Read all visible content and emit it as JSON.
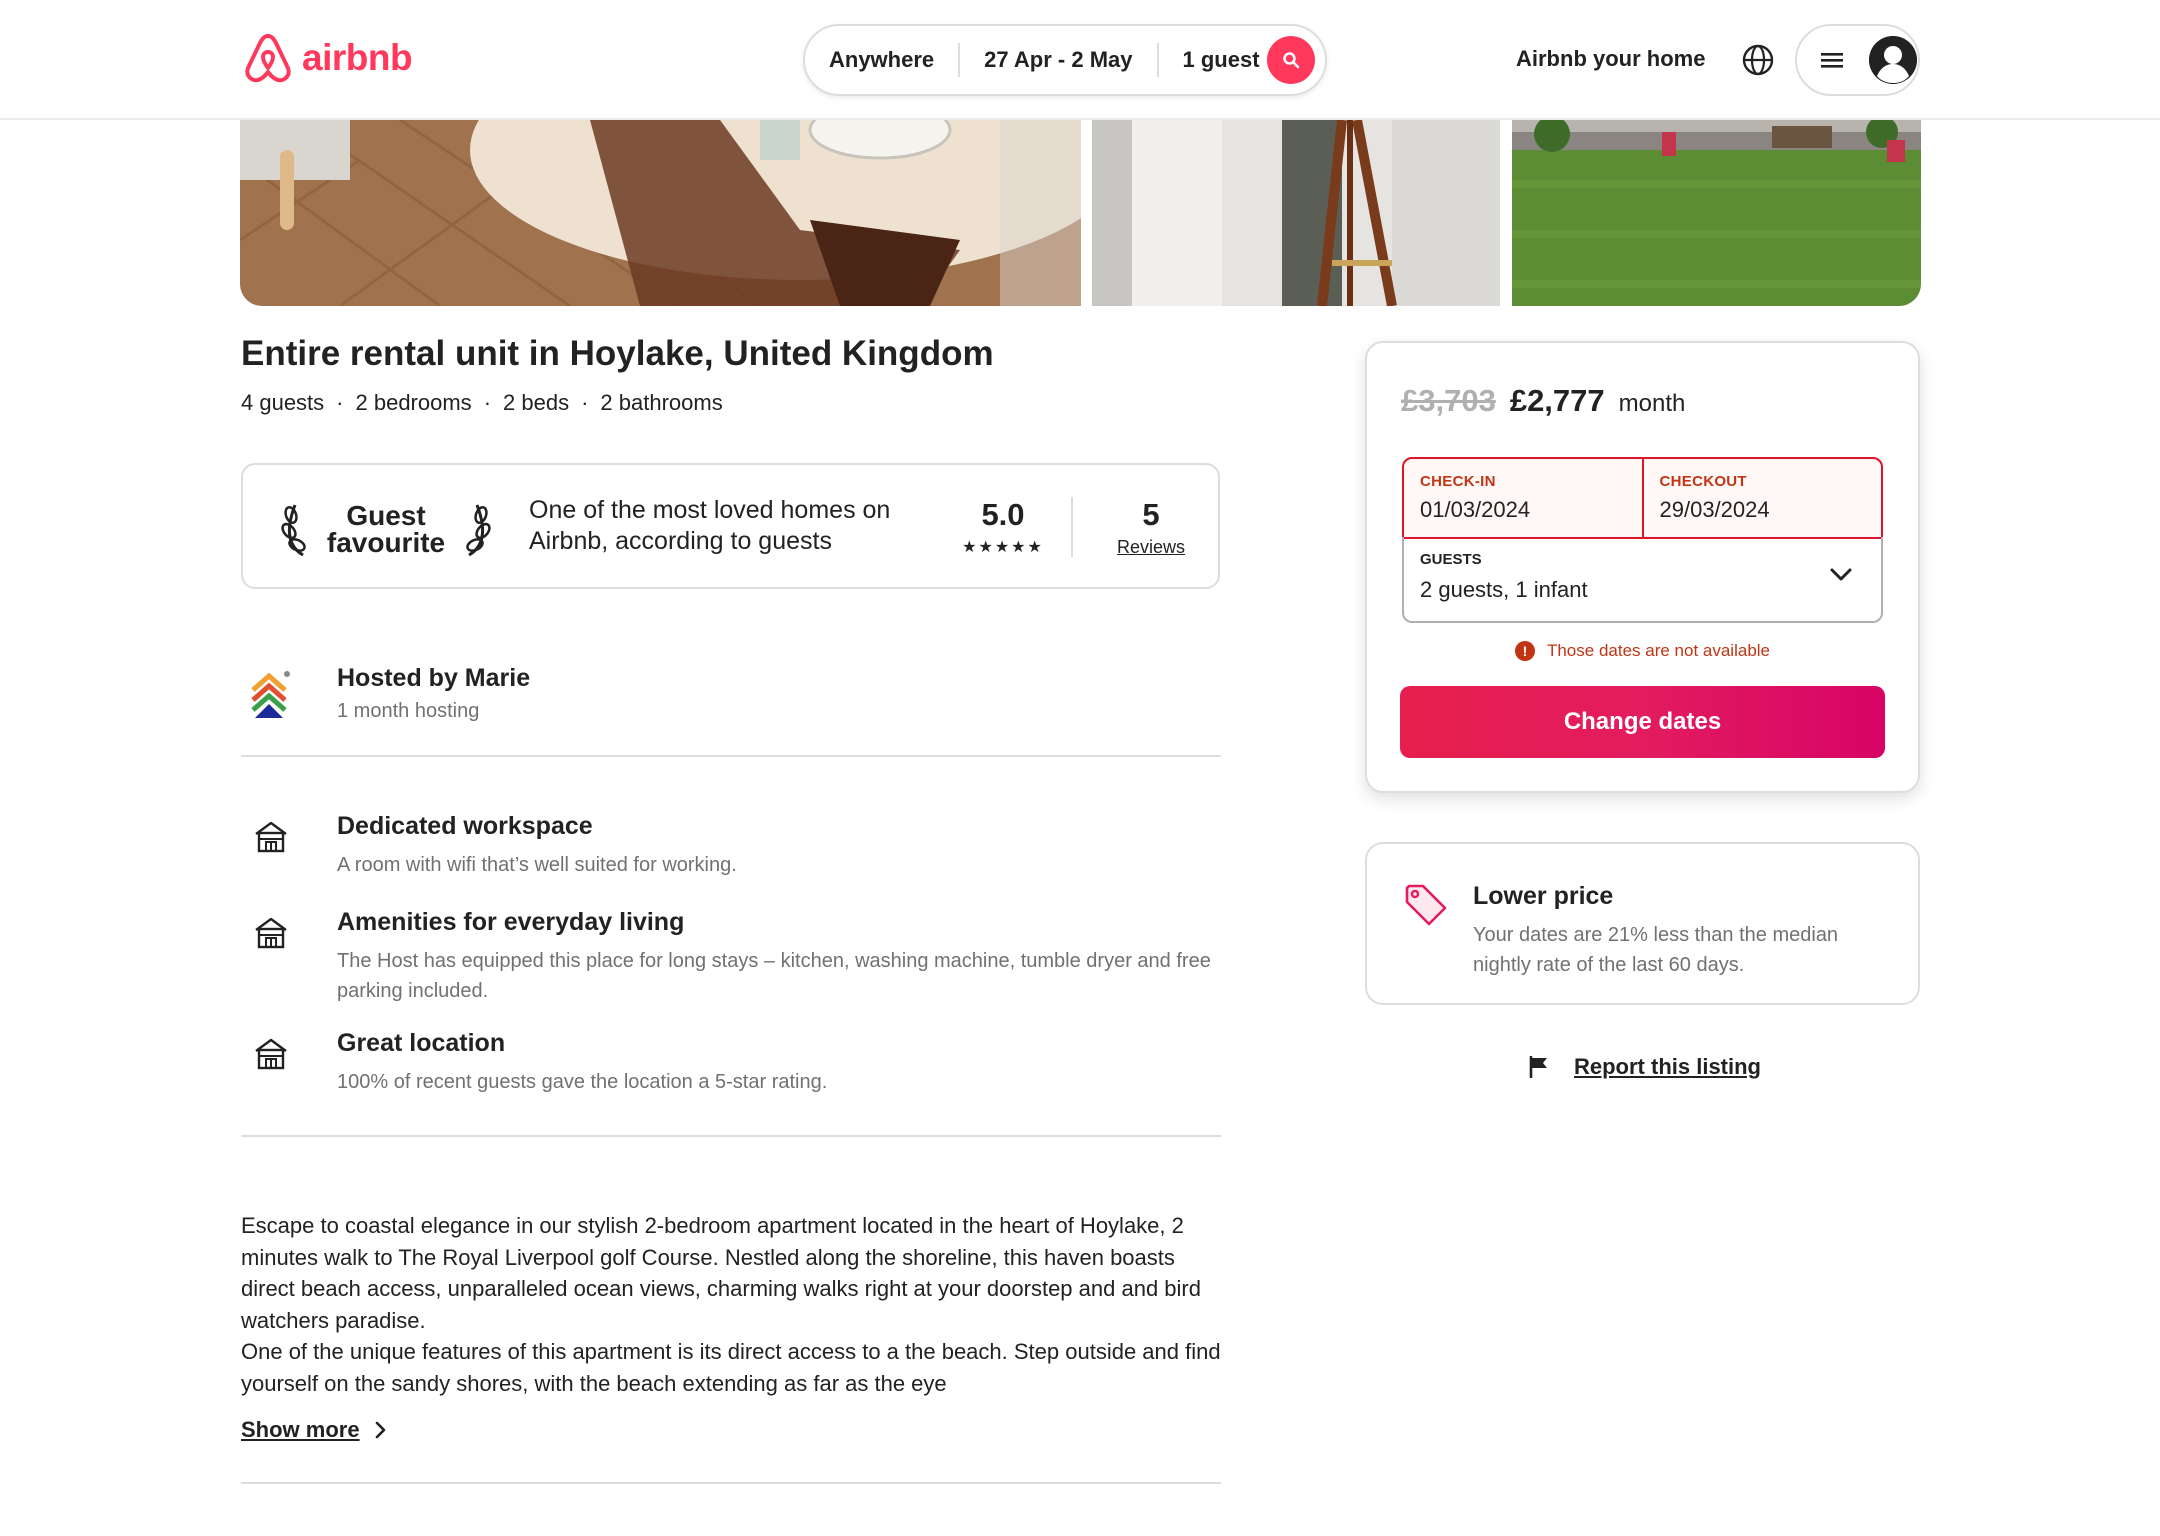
{
  "brand": {
    "name": "airbnb",
    "accent": "#ff385c"
  },
  "search": {
    "location": "Anywhere",
    "dates": "27 Apr - 2 May",
    "guests": "1 guest",
    "icon": "search-icon"
  },
  "header": {
    "host_link": "Airbnb your home",
    "globe_icon": "globe-icon",
    "menu_icon": "hamburger-icon",
    "avatar_icon": "user-avatar-icon"
  },
  "listing": {
    "title": "Entire rental unit in Hoylake, United Kingdom",
    "details": [
      "4 guests",
      "2 bedrooms",
      "2 beds",
      "2 bathrooms"
    ],
    "details_separator": "·"
  },
  "guest_favourite": {
    "badge_line1": "Guest",
    "badge_line2": "favourite",
    "description": "One of the most loved homes on Airbnb, according to guests",
    "rating": "5.0",
    "stars": "★★★★★",
    "reviews_count": "5",
    "reviews_label": "Reviews"
  },
  "host": {
    "name": "Hosted by Marie",
    "tenure": "1 month hosting"
  },
  "features": [
    {
      "title": "Dedicated workspace",
      "description": "A room with wifi that’s well suited for working.",
      "icon": "house-icon"
    },
    {
      "title": "Amenities for everyday living",
      "description": "The Host has equipped this place for long stays – kitchen, washing machine, tumble dryer and free parking included.",
      "icon": "house-icon"
    },
    {
      "title": "Great location",
      "description": "100% of recent guests gave the location a 5-star rating.",
      "icon": "house-icon"
    }
  ],
  "description": {
    "paragraph1": "Escape to coastal elegance in our stylish 2-bedroom apartment located in the heart of Hoylake, 2 minutes walk to The Royal Liverpool golf Course. Nestled along the shoreline, this haven boasts direct beach access, unparalleled ocean views, charming walks right at your doorstep and and bird watchers paradise.",
    "paragraph2": "One of the unique features of this apartment is its direct access to a the  beach. Step outside and find yourself on the sandy shores, with the beach extending as far as the eye",
    "show_more": "Show more"
  },
  "booking": {
    "old_price": "£3,703",
    "new_price": "£2,777",
    "unit": "month",
    "checkin_label": "CHECK-IN",
    "checkin_value": "01/03/2024",
    "checkout_label": "CHECKOUT",
    "checkout_value": "29/03/2024",
    "guests_label": "GUESTS",
    "guests_value": "2 guests, 1 infant",
    "error_text": "Those dates are not available",
    "button_label": "Change dates",
    "error_color": "#c13515"
  },
  "lower_price": {
    "title": "Lower price",
    "description": "Your dates are 21% less than the median nightly rate of the last 60 days.",
    "icon": "price-tag-icon"
  },
  "report": {
    "label": "Report this listing",
    "icon": "flag-icon"
  }
}
